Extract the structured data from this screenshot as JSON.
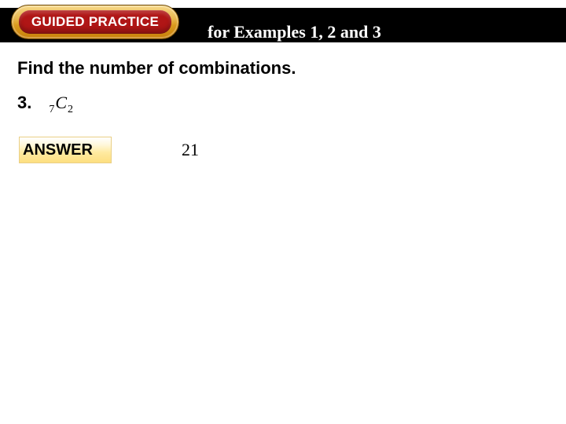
{
  "header": {
    "badge_label": "GUIDED PRACTICE",
    "subtitle": "for Examples 1, 2 and 3"
  },
  "instruction": "Find the number of combinations.",
  "problem": {
    "number_label": "3.",
    "combination": {
      "n": "7",
      "symbol": "C",
      "r": "2"
    }
  },
  "answer": {
    "label": "ANSWER",
    "value": "21"
  }
}
